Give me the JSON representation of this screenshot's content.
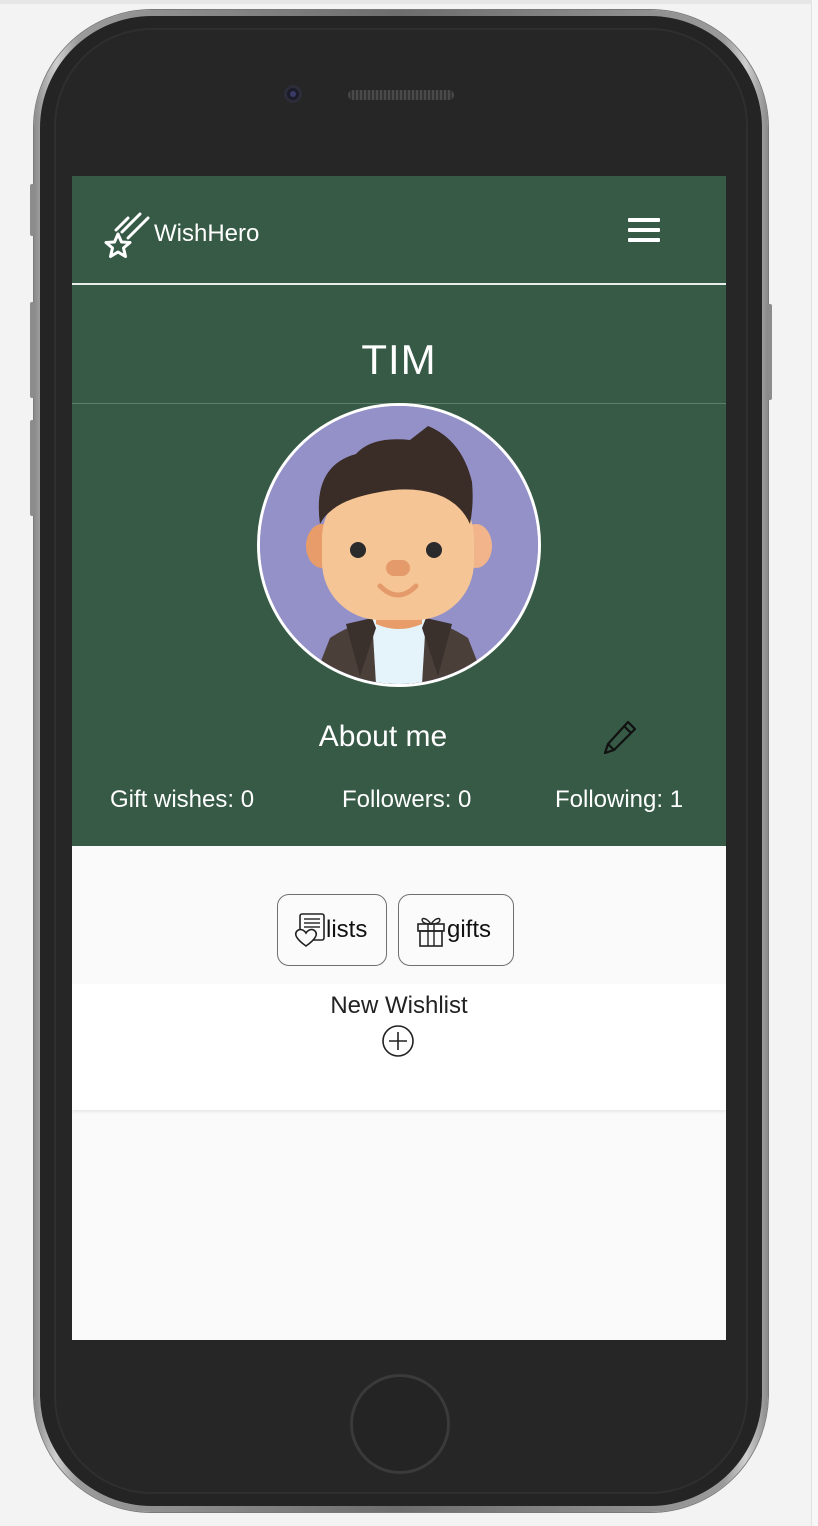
{
  "app": {
    "brand_name": "WishHero"
  },
  "profile": {
    "username": "TIM",
    "about_title": "About me",
    "stats": {
      "gift_wishes": "Gift wishes: 0",
      "followers": "Followers: 0",
      "following": "Following: 1"
    }
  },
  "tabs": [
    {
      "label": "lists",
      "icon": "heart-list-icon"
    },
    {
      "label": "gifts",
      "icon": "gift-icon"
    }
  ],
  "wishlist": {
    "new_label": "New Wishlist",
    "add_icon": "plus-circle-icon"
  },
  "icons": {
    "brand": "shooting-star-icon",
    "menu": "hamburger-menu-icon",
    "edit": "pencil-icon"
  },
  "colors": {
    "header_bg": "#365a46",
    "avatar_bg": "#9391c8",
    "screen_bg": "#fafafa"
  }
}
